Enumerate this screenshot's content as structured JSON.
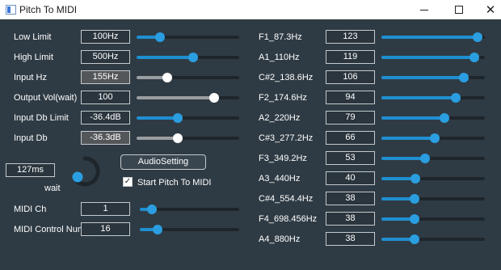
{
  "window": {
    "title": "Pitch To MIDI",
    "minimize": "—",
    "maximize": "☐",
    "close": "✕"
  },
  "left_controls": [
    {
      "label": "Low Limit",
      "value": "100Hz",
      "level": 0.2,
      "readonly": false,
      "white": false
    },
    {
      "label": "High Limit",
      "value": "500Hz",
      "level": 0.56,
      "readonly": false,
      "white": false
    },
    {
      "label": "Input Hz",
      "value": "155Hz",
      "level": 0.28,
      "readonly": true,
      "white": true
    },
    {
      "label": "Output Vol(wait)",
      "value": "100",
      "level": 0.78,
      "readonly": false,
      "white": true
    },
    {
      "label": "Input Db Limit",
      "value": "-36.4dB",
      "level": 0.39,
      "readonly": false,
      "white": false
    },
    {
      "label": "Input Db",
      "value": "-36.3dB",
      "level": 0.39,
      "readonly": true,
      "white": true
    }
  ],
  "wait": {
    "value": "127ms",
    "label": "wait"
  },
  "audio_setting": {
    "label": "AudioSetting"
  },
  "start_pitch": {
    "label": "Start Pitch To MIDI",
    "checked": true,
    "mark": "✓"
  },
  "midi": [
    {
      "label": "MIDI Ch",
      "value": "1",
      "level": 0.08
    },
    {
      "label": "MIDI Control Num",
      "value": "16",
      "level": 0.14
    }
  ],
  "notes": [
    {
      "label": "F1_87.3Hz",
      "value": "123",
      "level": 0.97
    },
    {
      "label": "A1_110Hz",
      "value": "119",
      "level": 0.94
    },
    {
      "label": "C#2_138.6Hz",
      "value": "106",
      "level": 0.83
    },
    {
      "label": "F2_174.6Hz",
      "value": "94",
      "level": 0.74
    },
    {
      "label": "A2_220Hz",
      "value": "79",
      "level": 0.62
    },
    {
      "label": "C#3_277.2Hz",
      "value": "66",
      "level": 0.52
    },
    {
      "label": "F3_349.2Hz",
      "value": "53",
      "level": 0.41
    },
    {
      "label": "A3_440Hz",
      "value": "40",
      "level": 0.31
    },
    {
      "label": "C#4_554.4Hz",
      "value": "38",
      "level": 0.3
    },
    {
      "label": "F4_698.456Hz",
      "value": "38",
      "level": 0.3
    },
    {
      "label": "A4_880Hz",
      "value": "38",
      "level": 0.3
    }
  ],
  "colors": {
    "background": "#2f3b44",
    "accent": "#2a9ee0",
    "text": "#ffffff"
  }
}
